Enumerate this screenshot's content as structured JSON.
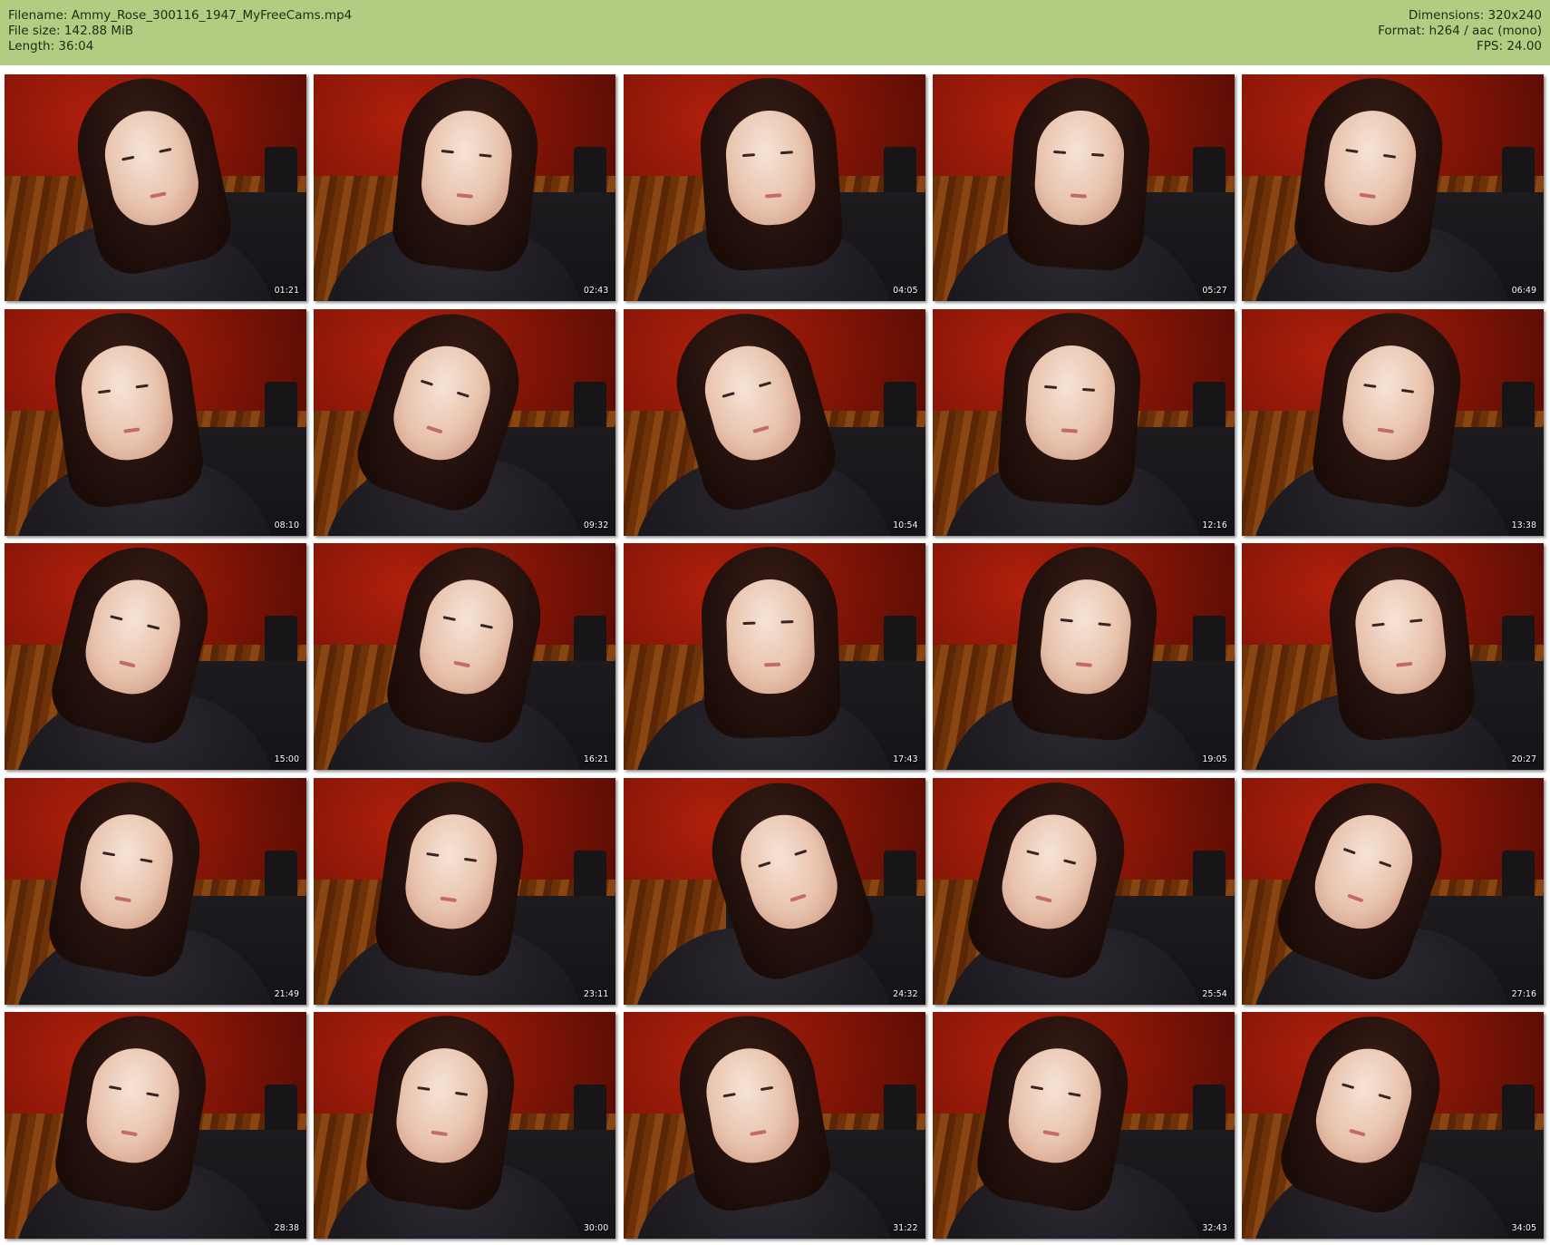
{
  "header": {
    "filename": "Filename: Ammy_Rose_300116_1947_MyFreeCams.mp4",
    "file_size": "File size: 142.88 MiB",
    "length": "Length: 36:04",
    "dimensions": "Dimensions: 320x240",
    "format": "Format: h264 / aac (mono)",
    "fps": "FPS: 24.00"
  },
  "colors": {
    "header_bg": "#b2cc82",
    "page_bg": "#ffffff"
  },
  "thumbnails": [
    {
      "timestamp": "01:21"
    },
    {
      "timestamp": "02:43"
    },
    {
      "timestamp": "04:05"
    },
    {
      "timestamp": "05:27"
    },
    {
      "timestamp": "06:49"
    },
    {
      "timestamp": "08:10"
    },
    {
      "timestamp": "09:32"
    },
    {
      "timestamp": "10:54"
    },
    {
      "timestamp": "12:16"
    },
    {
      "timestamp": "13:38"
    },
    {
      "timestamp": "15:00"
    },
    {
      "timestamp": "16:21"
    },
    {
      "timestamp": "17:43"
    },
    {
      "timestamp": "19:05"
    },
    {
      "timestamp": "20:27"
    },
    {
      "timestamp": "21:49"
    },
    {
      "timestamp": "23:11"
    },
    {
      "timestamp": "24:32"
    },
    {
      "timestamp": "25:54"
    },
    {
      "timestamp": "27:16"
    },
    {
      "timestamp": "28:38"
    },
    {
      "timestamp": "30:00"
    },
    {
      "timestamp": "31:22"
    },
    {
      "timestamp": "32:43"
    },
    {
      "timestamp": "34:05"
    }
  ]
}
